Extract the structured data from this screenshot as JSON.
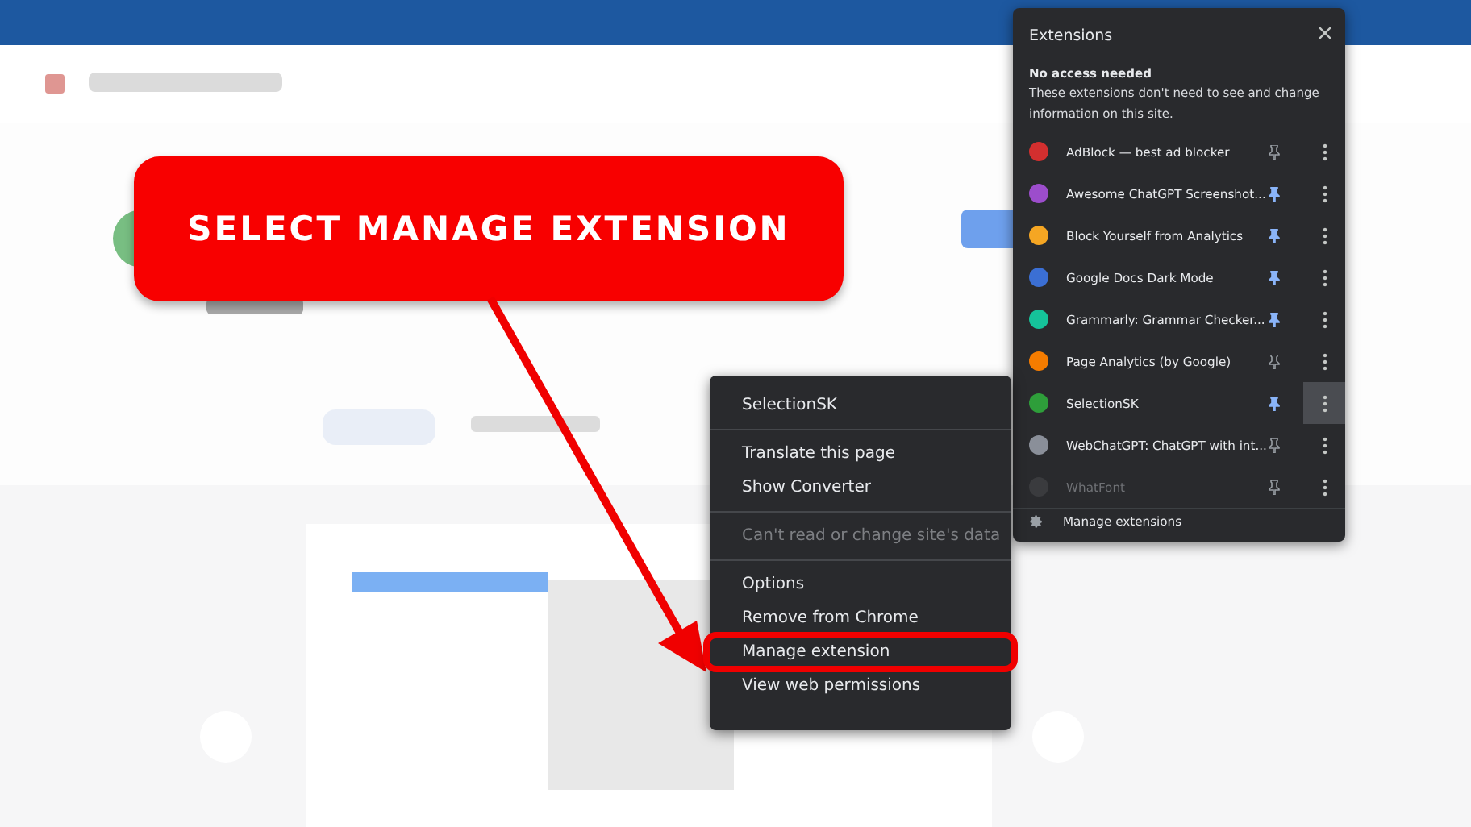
{
  "callout": {
    "text": "SELECT MANAGE EXTENSION"
  },
  "extensions_panel": {
    "title": "Extensions",
    "section_heading": "No access needed",
    "section_description": "These extensions don't need to see and change information on this site.",
    "items": [
      {
        "name": "AdBlock — best ad blocker",
        "color": "#d32f2f",
        "pinned": false,
        "disabled": false,
        "hovered": false
      },
      {
        "name": "Awesome ChatGPT Screenshot...",
        "color": "#9c4dcc",
        "pinned": true,
        "disabled": false,
        "hovered": false
      },
      {
        "name": "Block Yourself from Analytics",
        "color": "#f5a623",
        "pinned": true,
        "disabled": false,
        "hovered": false
      },
      {
        "name": "Google Docs Dark Mode",
        "color": "#3b6fd4",
        "pinned": true,
        "disabled": false,
        "hovered": false
      },
      {
        "name": "Grammarly: Grammar Checker...",
        "color": "#15c39a",
        "pinned": true,
        "disabled": false,
        "hovered": false
      },
      {
        "name": "Page Analytics (by Google)",
        "color": "#f57c00",
        "pinned": false,
        "disabled": false,
        "hovered": false
      },
      {
        "name": "SelectionSK",
        "color": "#2e9e3a",
        "pinned": true,
        "disabled": false,
        "hovered": true
      },
      {
        "name": "WebChatGPT: ChatGPT with int...",
        "color": "#8a8f99",
        "pinned": false,
        "disabled": false,
        "hovered": false
      },
      {
        "name": "WhatFont",
        "color": "#3a3b3e",
        "pinned": false,
        "disabled": true,
        "hovered": false
      }
    ],
    "footer": "Manage extensions"
  },
  "context_menu": {
    "groups": [
      [
        {
          "label": "SelectionSK",
          "disabled": false,
          "highlighted": false
        }
      ],
      [
        {
          "label": "Translate this page",
          "disabled": false,
          "highlighted": false
        },
        {
          "label": "Show Converter",
          "disabled": false,
          "highlighted": false
        }
      ],
      [
        {
          "label": "Can't read or change site's data",
          "disabled": true,
          "highlighted": false
        }
      ],
      [
        {
          "label": "Options",
          "disabled": false,
          "highlighted": false
        },
        {
          "label": "Remove from Chrome",
          "disabled": false,
          "highlighted": false
        },
        {
          "label": "Manage extension",
          "disabled": false,
          "highlighted": true
        },
        {
          "label": "View web permissions",
          "disabled": false,
          "highlighted": false
        }
      ]
    ]
  }
}
